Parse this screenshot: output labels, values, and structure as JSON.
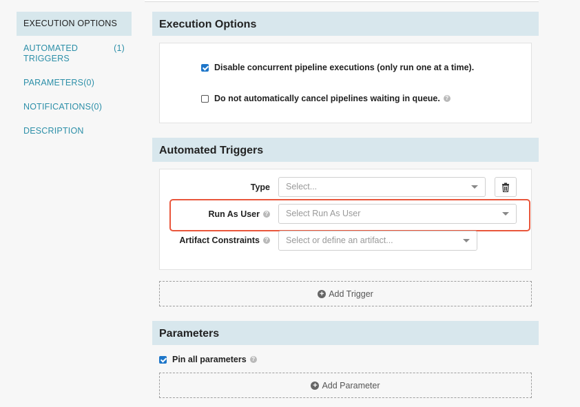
{
  "sidebar": {
    "items": [
      {
        "label": "EXECUTION OPTIONS",
        "count": ""
      },
      {
        "label": "AUTOMATED TRIGGERS",
        "count": "(1)"
      },
      {
        "label": "PARAMETERS(0)",
        "count": ""
      },
      {
        "label": "NOTIFICATIONS(0)",
        "count": ""
      },
      {
        "label": "DESCRIPTION",
        "count": ""
      }
    ]
  },
  "execution": {
    "title": "Execution Options",
    "disable_concurrent": {
      "label": "Disable concurrent pipeline executions (only run one at a time).",
      "checked": true
    },
    "no_cancel": {
      "label": "Do not automatically cancel pipelines waiting in queue.",
      "checked": false
    }
  },
  "triggers": {
    "title": "Automated Triggers",
    "type_label": "Type",
    "type_placeholder": "Select...",
    "run_as_label": "Run As User",
    "run_as_placeholder": "Select Run As User",
    "artifact_label": "Artifact Constraints",
    "artifact_placeholder": "Select or define an artifact...",
    "add_label": "Add Trigger"
  },
  "parameters": {
    "title": "Parameters",
    "pin_all_label": "Pin all parameters",
    "pin_all_checked": true,
    "add_label": "Add Parameter"
  },
  "colors": {
    "accent": "#2c8fa8",
    "header_bg": "#d8e7ed",
    "checkbox": "#1e76c9",
    "highlight": "#e9553a"
  }
}
